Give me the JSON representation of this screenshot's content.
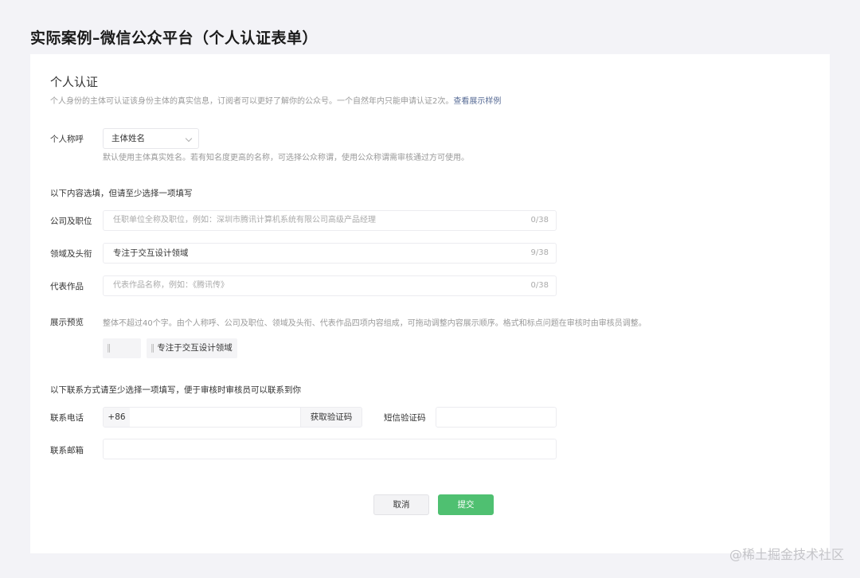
{
  "page_title": "实际案例–微信公众平台（个人认证表单）",
  "section": {
    "title": "个人认证",
    "description": "个人身份的主体可认证该身份主体的真实信息，订阅者可以更好了解你的公众号。一个自然年内只能申请认证2次。",
    "description_link": "查看展示样例"
  },
  "salutation": {
    "label": "个人称呼",
    "selected": "主体姓名",
    "hint": "默认使用主体真实姓名。若有知名度更高的名称，可选择公众称谓，使用公众称谓需审核通过方可使用。"
  },
  "optional_group_title": "以下内容选填，但请至少选择一项填写",
  "fields": {
    "company": {
      "label": "公司及职位",
      "placeholder": "任职单位全称及职位，例如：深圳市腾讯计算机系统有限公司高级产品经理",
      "value": "",
      "count": "0/38"
    },
    "domain": {
      "label": "领域及头衔",
      "placeholder": "",
      "value": "专注于交互设计领域",
      "count": "9/38"
    },
    "works": {
      "label": "代表作品",
      "placeholder": "代表作品名称，例如：《腾讯传》",
      "value": "",
      "count": "0/38"
    }
  },
  "preview": {
    "label": "展示预览",
    "hint": "整体不超过40个字。由个人称呼、公司及职位、领域及头衔、代表作品四项内容组成，可拖动调整内容展示顺序。格式和标点问题在审核时由审核员调整。",
    "chips": [
      "",
      "专注于交互设计领域"
    ],
    "handle_glyph": "‖"
  },
  "contact_group_title": "以下联系方式请至少选择一项填写，便于审核时审核员可以联系到你",
  "contact": {
    "phone_label": "联系电话",
    "phone_prefix": "+86",
    "phone_value": "",
    "get_code_label": "获取验证码",
    "sms_label": "短信验证码",
    "sms_value": "",
    "email_label": "联系邮箱",
    "email_value": ""
  },
  "actions": {
    "cancel_label": "取消",
    "submit_label": "提交"
  },
  "watermark": "@稀土掘金技术社区",
  "colors": {
    "page_background": "#f3f3f7",
    "card_background": "#ffffff",
    "link": "#576b95",
    "submit_button": "#4fc071"
  }
}
